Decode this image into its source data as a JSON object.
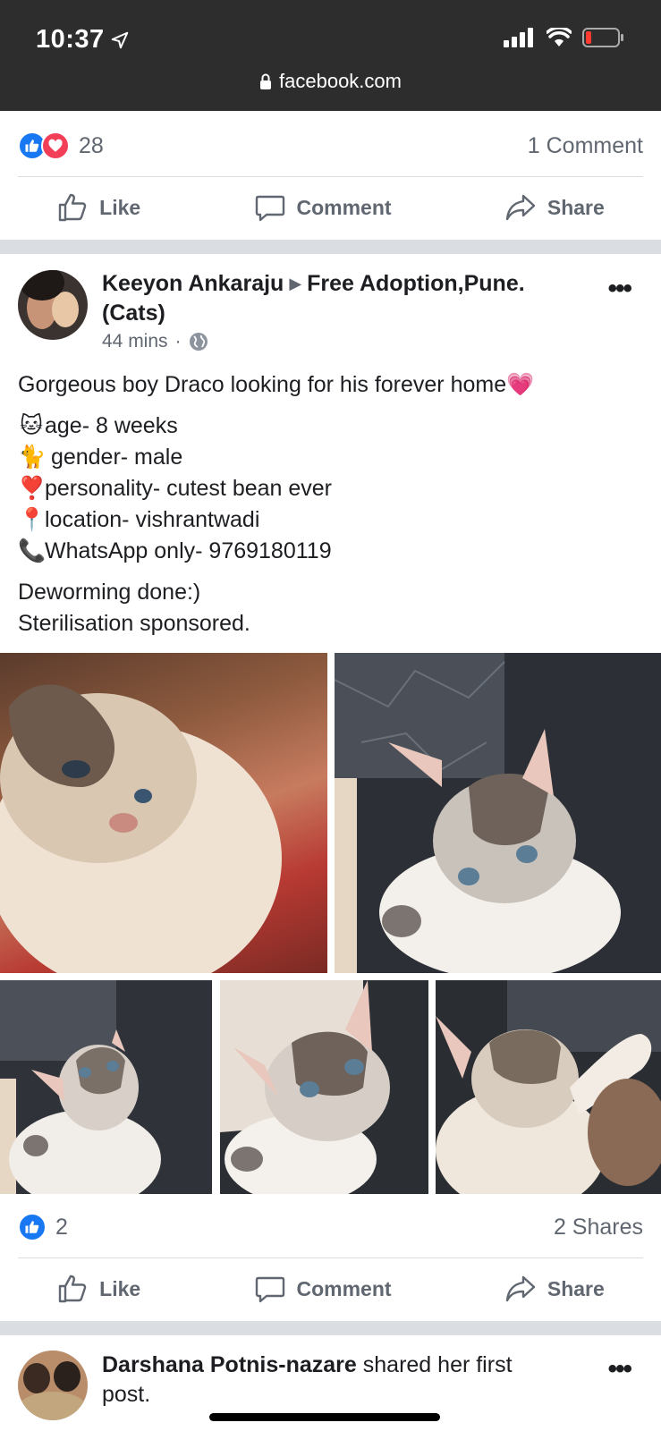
{
  "status_bar": {
    "time": "10:37",
    "url": "facebook.com"
  },
  "previous_post": {
    "reaction_count": "28",
    "comment_count": "1 Comment",
    "actions": {
      "like": "Like",
      "comment": "Comment",
      "share": "Share"
    }
  },
  "post": {
    "author": "Keeyon Ankaraju",
    "group": "Free Adoption,Pune.",
    "group_line2": "(Cats)",
    "timestamp": "44 mins",
    "separator": "·",
    "headline": "Gorgeous boy Draco looking for his forever home",
    "headline_emoji": "💗",
    "details": [
      {
        "emoji": "🐱",
        "text": "age- 8 weeks"
      },
      {
        "emoji": "🐈",
        "text": " gender- male"
      },
      {
        "emoji": "❣️",
        "text": "personality- cutest bean ever"
      },
      {
        "emoji": "📍",
        "text": "location- vishrantwadi"
      },
      {
        "emoji": "📞",
        "text": "WhatsApp only- 9769180119"
      }
    ],
    "footer_lines": [
      "Deworming done:)",
      "Sterilisation sponsored."
    ],
    "reaction_count": "2",
    "share_count": "2 Shares",
    "actions": {
      "like": "Like",
      "comment": "Comment",
      "share": "Share"
    }
  },
  "next_post": {
    "author": "Darshana Potnis-nazare",
    "action_text": " shared her first",
    "action_text_2": "post."
  },
  "colors": {
    "like_blue": "#1877f2",
    "love_red": "#f33e58",
    "divider": "#dadde1",
    "secondary_text": "#606770"
  }
}
